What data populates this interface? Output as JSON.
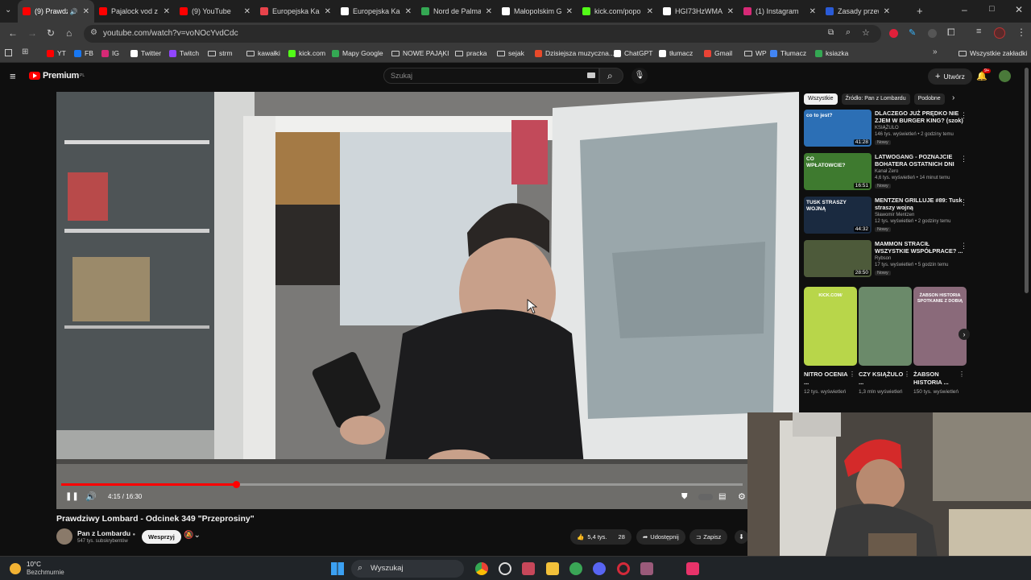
{
  "tabs": [
    {
      "title": "(9) Prawdzi",
      "favicon": "youtube-icon",
      "color": "#ff0000",
      "active": true
    },
    {
      "title": "Pajalock vod z",
      "favicon": "youtube-icon",
      "color": "#ff0000"
    },
    {
      "title": "(9) YouTube",
      "favicon": "youtube-icon",
      "color": "#ff0000"
    },
    {
      "title": "Europejska Ka",
      "favicon": "bookmark-icon",
      "color": "#e8434b"
    },
    {
      "title": "Europejska Ka",
      "favicon": "google-icon",
      "color": "#ffffff"
    },
    {
      "title": "Nord de Palma",
      "favicon": "maps-icon",
      "color": "#34a853"
    },
    {
      "title": "Małopolskim G",
      "favicon": "google-icon",
      "color": "#ffffff"
    },
    {
      "title": "kick.com/popo",
      "favicon": "kick-icon",
      "color": "#53fc18"
    },
    {
      "title": "HGI73HzWMA",
      "favicon": "x-icon",
      "color": "#ffffff"
    },
    {
      "title": "(1) Instagram",
      "favicon": "instagram-icon",
      "color": "#d62976"
    },
    {
      "title": "Zasady przew",
      "favicon": "shield-icon",
      "color": "#2a5bd7"
    }
  ],
  "address": {
    "url": "youtube.com/watch?v=voNOcYvdCdc"
  },
  "bookmarks": [
    {
      "label": "YT",
      "icon": "youtube-icon",
      "color": "#ff0000"
    },
    {
      "label": "FB",
      "icon": "facebook-icon",
      "color": "#1877f2"
    },
    {
      "label": "IG",
      "icon": "instagram-icon",
      "color": "#d62976"
    },
    {
      "label": "Twitter",
      "icon": "x-icon",
      "color": "#ffffff"
    },
    {
      "label": "Twitch",
      "icon": "twitch-icon",
      "color": "#9146ff"
    },
    {
      "label": "strm",
      "icon": "folder-icon"
    },
    {
      "label": "kawałki",
      "icon": "folder-icon"
    },
    {
      "label": "kick.com",
      "icon": "kick-icon",
      "color": "#53fc18"
    },
    {
      "label": "Mapy Google",
      "icon": "maps-icon",
      "color": "#34a853"
    },
    {
      "label": "NOWE PAJĄKI",
      "icon": "folder-icon"
    },
    {
      "label": "pracka",
      "icon": "folder-icon"
    },
    {
      "label": "sejak",
      "icon": "folder-icon"
    },
    {
      "label": "Dzisiejsza muzyczna...",
      "icon": "music-icon",
      "color": "#e84a2a"
    },
    {
      "label": "ChatGPT",
      "icon": "chatgpt-icon",
      "color": "#ffffff"
    },
    {
      "label": "tłumacz",
      "icon": "translate-icon",
      "color": "#ffffff"
    },
    {
      "label": "Gmail",
      "icon": "gmail-icon",
      "color": "#ea4335"
    },
    {
      "label": "WP",
      "icon": "folder-icon"
    },
    {
      "label": "Tłumacz",
      "icon": "translate-icon",
      "color": "#4285f4"
    },
    {
      "label": "ksiazka",
      "icon": "book-icon",
      "color": "#34a853"
    }
  ],
  "bookmarks_all": "Wszystkie zakładki",
  "youtube": {
    "logo_text": "Premium",
    "logo_suffix": "PL",
    "search_placeholder": "Szukaj",
    "create_label": "Utwórz",
    "notif_count": "9+"
  },
  "player": {
    "time": "4:15 / 16:30",
    "progress": 0.257
  },
  "video": {
    "title": "Prawdziwy Lombard - Odcinek 349 \"Przeprosiny\"",
    "channel": "Pan z Lombardu",
    "subscribers": "547 tys. subskrybentów",
    "join_label": "Wesprzyj",
    "likes": "5,4 tys.",
    "comments": "28",
    "share_label": "Udostępnij",
    "save_label": "Zapisz"
  },
  "chips": [
    "Wszystkie",
    "Źródło: Pan z Lombardu",
    "Podobne"
  ],
  "recommendations": [
    {
      "title": "DLACZEGO JUŻ PRĘDKO NIE ZJEM W BURGER KING? (szok)",
      "channel": "KSIĄŻULO",
      "meta": "146 tys. wyświetleń • 2 godziny temu",
      "badge": "Nowy",
      "duration": "41:28",
      "thumb_color": "#2c6fb5",
      "thumb_text": "co to jest?"
    },
    {
      "title": "LATWOGANG - POZNAJCIE BOHATERA OSTATNICH DNI",
      "channel": "Kanał Zero",
      "meta": "4,6 tys. wyświetleń • 14 minut temu",
      "badge": "Nowy",
      "duration": "16:51",
      "thumb_color": "#3e7a2f",
      "thumb_text": "CO WPŁATOWCIE?"
    },
    {
      "title": "MENTZEN GRILLUJE #89: Tusk straszy wojną",
      "channel": "Sławomir Mentzen",
      "meta": "12 tys. wyświetleń • 2 godziny temu",
      "badge": "Nowy",
      "duration": "44:32",
      "thumb_color": "#1a2a40",
      "thumb_text": "TUSK STRASZY WOJNĄ"
    },
    {
      "title": "MAMMON STRACIŁ WSZYSTKIE WSPÓŁPRACE? ...",
      "channel": "Rybson",
      "meta": "17 tys. wyświetleń • 5 godzin temu",
      "badge": "Nowy",
      "duration": "28:50",
      "thumb_color": "#4d5a3a",
      "thumb_text": ""
    }
  ],
  "shorts": [
    {
      "title": "NITRO OCENIA ...",
      "views": "12 tys. wyświetleń",
      "color": "#b8d64a",
      "overlay": "KICK.COM/"
    },
    {
      "title": "CZY KSIĄŻULO ...",
      "views": "1,3 mln wyświetleń",
      "color": "#6b8a6a",
      "overlay": ""
    },
    {
      "title": "ŻABSON HISTORIA ...",
      "views": "150 tys. wyświetleń",
      "color": "#8a6a7a",
      "overlay": "ŻABSON HISTORIA SPOTKANIE Z DOBIĄ"
    }
  ],
  "weather": {
    "temp": "10°C",
    "condition": "Bezchmurnie"
  },
  "taskbar": {
    "search_placeholder": "Wyszukaj"
  }
}
